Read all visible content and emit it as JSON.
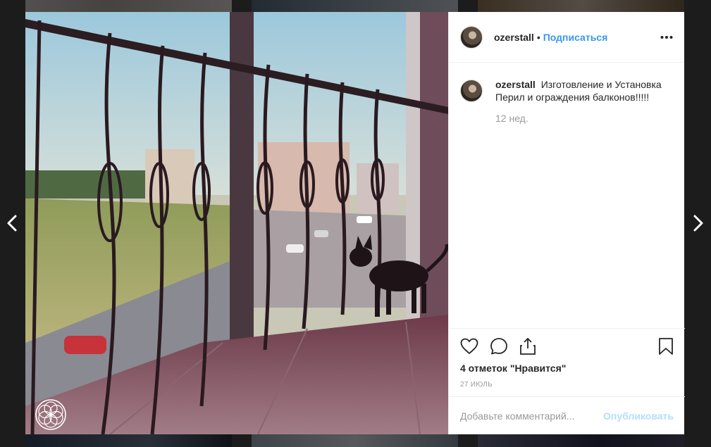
{
  "post": {
    "username": "ozerstall",
    "separator": "•",
    "follow_label": "Подписаться",
    "caption_username": "ozerstall",
    "caption_text": "Изготовление и Установка Перил и ограждения балконов!!!!!",
    "caption_time": "12 нед.",
    "likes_text": "4 отметок \"Нравится\"",
    "date": "27 ИЮЛЬ"
  },
  "comment": {
    "placeholder": "Добавьте комментарий...",
    "publish_label": "Опубликовать"
  },
  "icons": {
    "prev": "chevron-left-icon",
    "next": "chevron-right-icon",
    "more": "more-options-icon",
    "like": "heart-icon",
    "comment": "comment-icon",
    "share": "share-icon",
    "save": "bookmark-icon"
  },
  "colors": {
    "accent": "#3897f0",
    "publish_disabled": "#b2dffc",
    "text": "#262626",
    "muted": "#999999"
  }
}
